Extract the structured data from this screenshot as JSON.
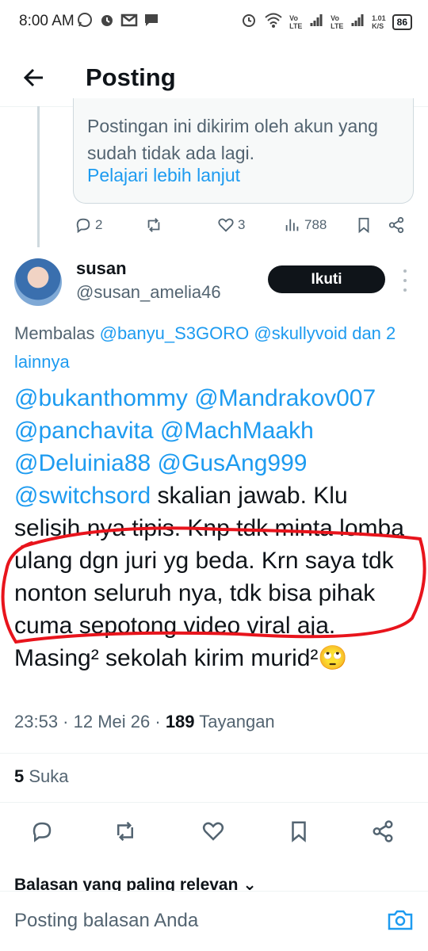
{
  "status_bar": {
    "time": "8:00 AM",
    "net_speed_top": "1.01",
    "net_speed_unit": "K/S",
    "battery": "86",
    "lte1": "Vo LTE",
    "lte2": "Vo LTE"
  },
  "header": {
    "title": "Posting"
  },
  "quoted_card": {
    "text": "Postingan ini dikirim oleh akun yang sudah tidak ada lagi.",
    "link": "Pelajari lebih lanjut"
  },
  "parent_actions": {
    "replies": "2",
    "likes": "3",
    "views": "788"
  },
  "author": {
    "name": "susan",
    "handle": "@susan_amelia46",
    "follow_label": "Ikuti"
  },
  "reply_to": {
    "prefix": "Membalas",
    "mentions": "@banyu_S3GORO @skullyvoid",
    "suffix": "dan 2 lainnya"
  },
  "tweet": {
    "mentions": "@bukanthommy @Mandrakov007 @panchavita @MachMaakh @Deluinia88 @GusAng999 @switchsord",
    "text": " skalian jawab. Klu selisih nya tipis. Knp tdk minta lomba ulang dgn juri yg beda. Krn saya tdk nonton seluruh nya, tdk bisa pihak cuma sepotong video viral aja. Masing² sekolah kirim murid²🙄"
  },
  "meta": {
    "time": "23:53",
    "date": "12 Mei 26",
    "views_count": "189",
    "views_label": "Tayangan"
  },
  "likes_row": {
    "count": "5",
    "label": "Suka"
  },
  "replies_section": {
    "title": "Balasan yang paling relevan"
  },
  "composer": {
    "placeholder": "Posting balasan Anda"
  },
  "colors": {
    "accent": "#1d9bf0",
    "text": "#0f1419",
    "muted": "#536471",
    "annotation": "#e8141c"
  }
}
